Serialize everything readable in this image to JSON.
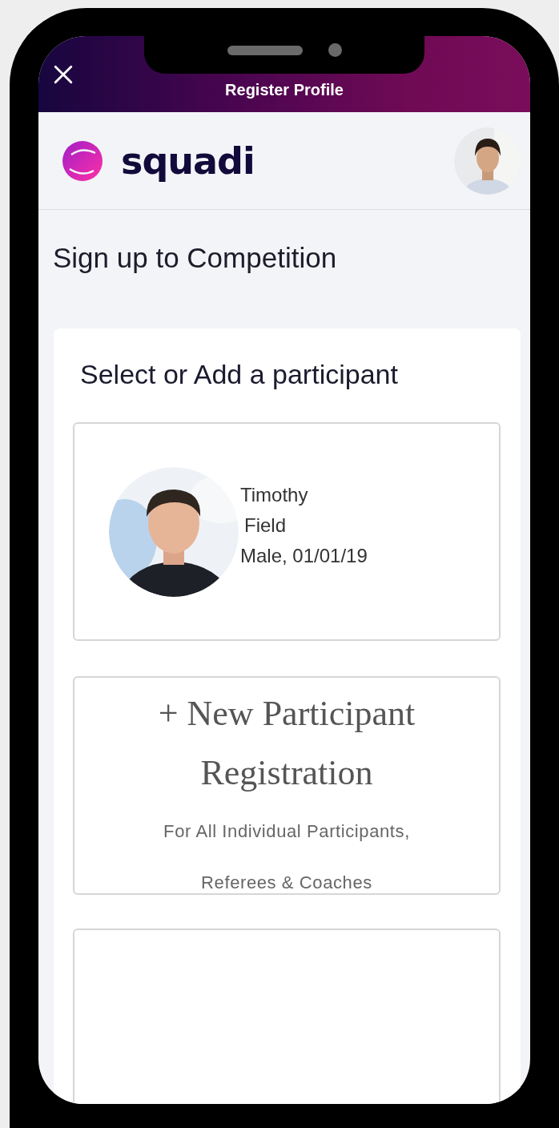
{
  "header": {
    "title": "Register Profile"
  },
  "brand": {
    "name": "squadi"
  },
  "page_title": "Sign up to Competition",
  "section": {
    "title": "Select or Add a participant",
    "participants": [
      {
        "first_name": "Timothy",
        "last_name": "Field",
        "details": "Male, 01/01/19"
      }
    ],
    "new_participant": {
      "title": "+ New Participant Registration",
      "subtitle_lines": [
        "For All Individual Participants,",
        "Referees & Coaches"
      ]
    }
  }
}
